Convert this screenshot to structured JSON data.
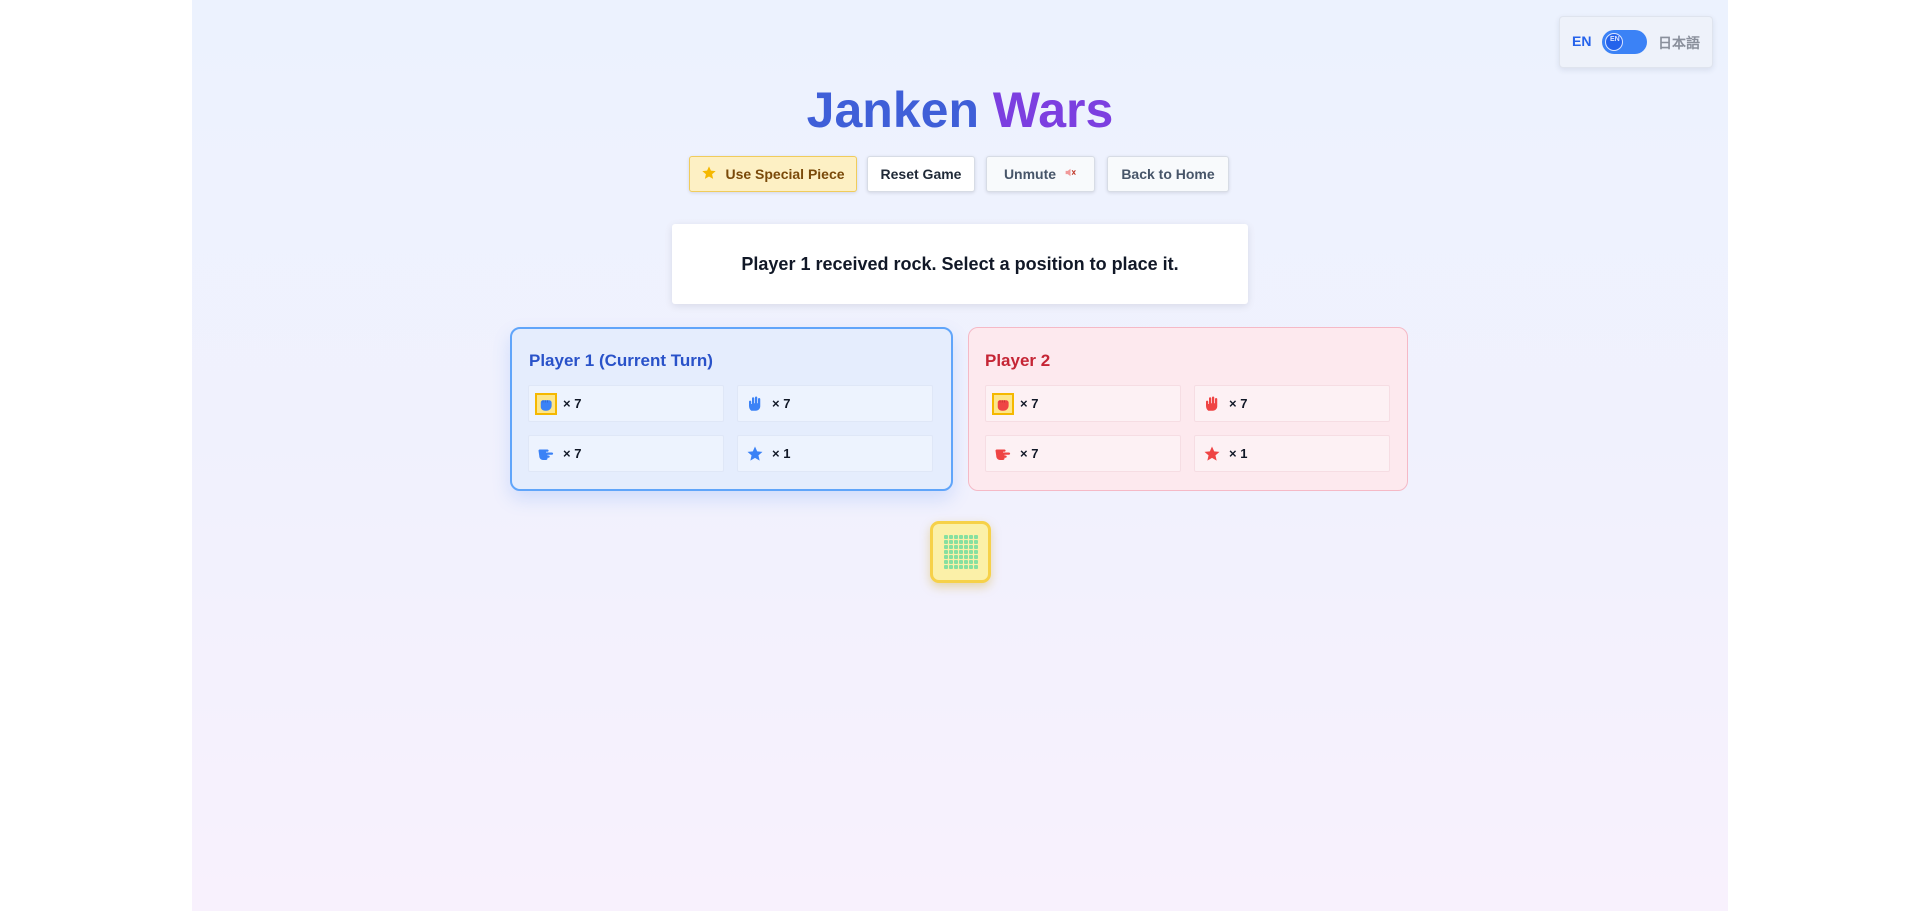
{
  "language_toggle": {
    "left_label": "EN",
    "right_label": "日本語",
    "knob_text": "EN",
    "selected": "EN"
  },
  "title": {
    "word1": "Janken",
    "word2": "Wars"
  },
  "toolbar": {
    "special_label": "Use Special Piece",
    "reset_label": "Reset Game",
    "unmute_label": "Unmute",
    "home_label": "Back to Home"
  },
  "status_message": "Player 1 received rock. Select a position to place it.",
  "players": [
    {
      "name": "Player 1 (Current Turn)",
      "color": "#3b82f6",
      "is_current_turn": true,
      "pieces": [
        {
          "icon": "rock-fist-icon",
          "count": "× 7",
          "selected": true
        },
        {
          "icon": "paper-hand-icon",
          "count": "× 7",
          "selected": false
        },
        {
          "icon": "scissors-hand-icon",
          "count": "× 7",
          "selected": false
        },
        {
          "icon": "special-star-icon",
          "count": "× 1",
          "selected": false
        }
      ]
    },
    {
      "name": "Player 2",
      "color": "#ef4444",
      "is_current_turn": false,
      "pieces": [
        {
          "icon": "rock-fist-icon",
          "count": "× 7",
          "selected": true
        },
        {
          "icon": "paper-hand-icon",
          "count": "× 7",
          "selected": false
        },
        {
          "icon": "scissors-hand-icon",
          "count": "× 7",
          "selected": false
        },
        {
          "icon": "special-star-icon",
          "count": "× 1",
          "selected": false
        }
      ]
    }
  ],
  "colors": {
    "accent_blue": "#3b82f6",
    "accent_red": "#ef4444",
    "special_yellow": "#f5b800",
    "board_cell_green": "#86e0a0"
  }
}
